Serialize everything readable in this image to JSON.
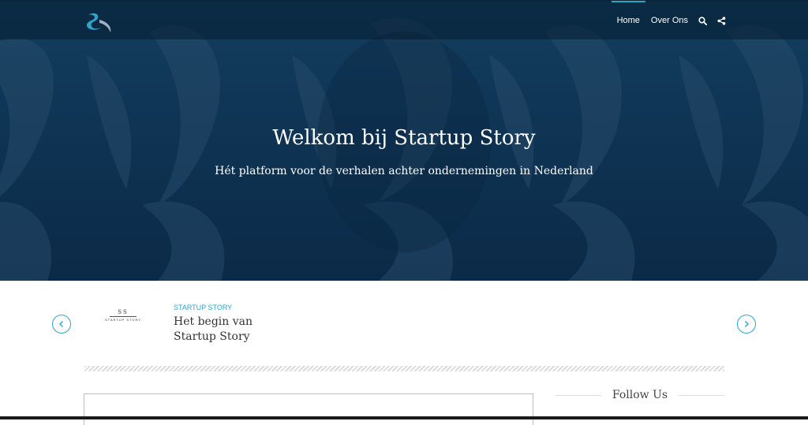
{
  "nav": {
    "items": [
      {
        "label": "Home",
        "active": true
      },
      {
        "label": "Over Ons",
        "active": false
      }
    ],
    "icons": [
      "search-icon",
      "share-icon"
    ]
  },
  "hero": {
    "title": "Welkom bij Startup Story",
    "subtitle": "Hét platform voor de verhalen achter ondernemingen in Nederland"
  },
  "carousel": {
    "post": {
      "category": "STARTUP STORY",
      "title": "Het begin van Startup Story",
      "thumb_monogram": "SS",
      "thumb_text": "STARTUP STORY"
    },
    "prev_icon": "chevron-left-icon",
    "next_icon": "chevron-right-icon"
  },
  "sidebar": {
    "follow_title": "Follow Us"
  },
  "colors": {
    "accent": "#2fa3c9",
    "hero_dark": "#0b2a47",
    "hero_light": "#123e5f"
  }
}
